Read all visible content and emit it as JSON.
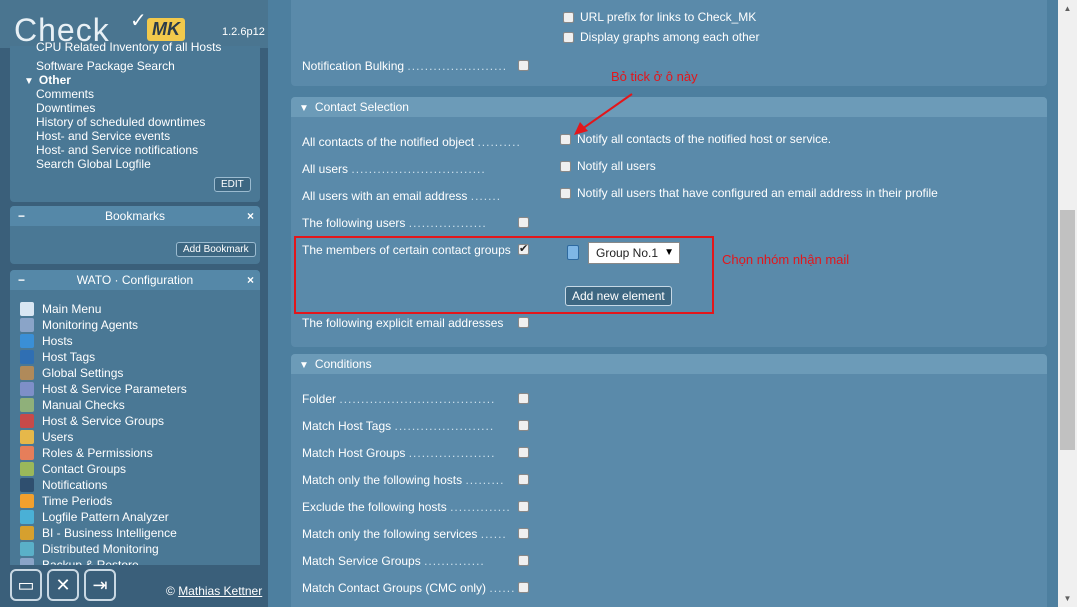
{
  "logo": {
    "check": "Check",
    "mk": "MK",
    "version": "1.2.6p12"
  },
  "views": {
    "cut_item": "CPU Related Inventory of all Hosts",
    "item_sw": "Software Package Search",
    "group_other": "Other",
    "items": [
      "Comments",
      "Downtimes",
      "History of scheduled downtimes",
      "Host- and Service events",
      "Host- and Service notifications",
      "Search Global Logfile"
    ],
    "edit_label": "EDIT"
  },
  "bookmarks": {
    "title": "Bookmarks",
    "add_label": "Add Bookmark"
  },
  "wato": {
    "title": "WATO · Configuration",
    "items": [
      {
        "label": "Main Menu",
        "icon": "home-icon",
        "color": "#d9e6f2"
      },
      {
        "label": "Monitoring Agents",
        "icon": "agent-icon",
        "color": "#8aa4c8"
      },
      {
        "label": "Hosts",
        "icon": "folder-icon",
        "color": "#3a8fd6"
      },
      {
        "label": "Host Tags",
        "icon": "tag-icon",
        "color": "#2f6fb3"
      },
      {
        "label": "Global Settings",
        "icon": "settings-box-icon",
        "color": "#b08a5a"
      },
      {
        "label": "Host & Service Parameters",
        "icon": "rules-icon",
        "color": "#7e8fc8"
      },
      {
        "label": "Manual Checks",
        "icon": "wrench-icon",
        "color": "#8fb07a"
      },
      {
        "label": "Host & Service Groups",
        "icon": "groups-icon",
        "color": "#c74a4a"
      },
      {
        "label": "Users",
        "icon": "users-icon",
        "color": "#e6b84a"
      },
      {
        "label": "Roles & Permissions",
        "icon": "roles-icon",
        "color": "#e67e5a"
      },
      {
        "label": "Contact Groups",
        "icon": "contactgroups-icon",
        "color": "#9ab85a"
      },
      {
        "label": "Notifications",
        "icon": "notification-icon",
        "color": "#2f4f6f"
      },
      {
        "label": "Time Periods",
        "icon": "clock-icon",
        "color": "#f2a02e"
      },
      {
        "label": "Logfile Pattern Analyzer",
        "icon": "logfile-icon",
        "color": "#4ab0d6"
      },
      {
        "label": "BI - Business Intelligence",
        "icon": "bi-icon",
        "color": "#d6a02e"
      },
      {
        "label": "Distributed Monitoring",
        "icon": "distributed-icon",
        "color": "#5ab0c8"
      },
      {
        "label": "Backup & Restore",
        "icon": "backup-icon",
        "color": "#8aa4c8"
      }
    ]
  },
  "footer": {
    "copyright_symbol": "©",
    "author": "Mathias Kettner"
  },
  "top_options": [
    "URL prefix for links to Check_MK",
    "Display graphs among each other"
  ],
  "notification_bulking": "Notification Bulking",
  "contact_selection": {
    "title": "Contact Selection",
    "rows": [
      {
        "label": "All contacts of the notified object",
        "option": "Notify all contacts of the notified host or service."
      },
      {
        "label": "All users",
        "option": "Notify all users"
      },
      {
        "label": "All users with an email address",
        "option": "Notify all users that have configured an email address in their profile"
      },
      {
        "label": "The following users"
      },
      {
        "label": "The members of certain contact groups"
      },
      {
        "label": "The following explicit email addresses"
      }
    ],
    "group_select_value": "Group No.1",
    "add_element": "Add new element"
  },
  "conditions": {
    "title": "Conditions",
    "rows": [
      "Folder",
      "Match Host Tags",
      "Match Host Groups",
      "Match only the following hosts",
      "Exclude the following hosts",
      "Match only the following services",
      "Match Service Groups",
      "Match Contact Groups (CMC only)"
    ]
  },
  "annotations": {
    "untick": "Bỏ tick ở ô này",
    "choose_group": "Chọn nhóm nhận mail"
  },
  "colors": {
    "annotation": "#e3161b",
    "sidebar": "#3a5f7a",
    "main": "#4d7f9f"
  }
}
